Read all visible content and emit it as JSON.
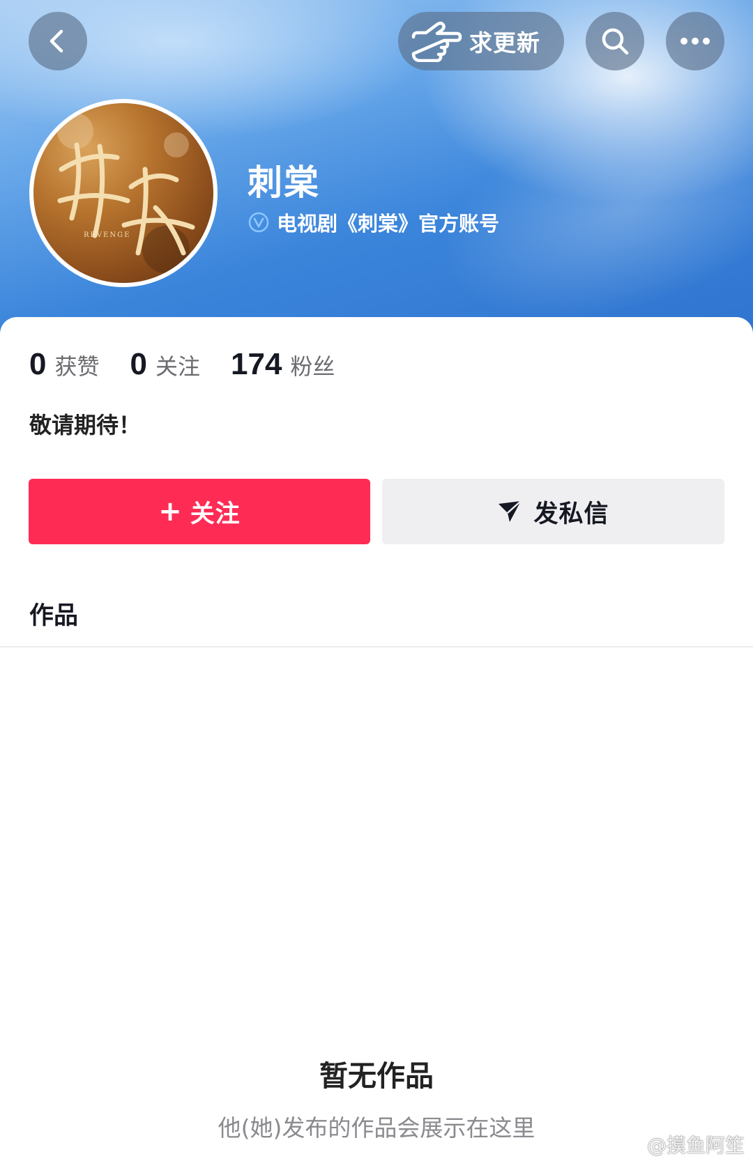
{
  "header": {
    "update_label": "求更新",
    "back_icon": "chevron-left-icon",
    "search_icon": "search-icon",
    "more_icon": "more-horizontal-icon",
    "update_icon": "pointing-hand-icon"
  },
  "profile": {
    "name": "刺棠",
    "verified_icon": "verified-v-icon",
    "verified_text": "电视剧《刺棠》官方账号",
    "avatar_text": "REVENGE"
  },
  "stats": [
    {
      "value": "0",
      "label": "获赞"
    },
    {
      "value": "0",
      "label": "关注"
    },
    {
      "value": "174",
      "label": "粉丝"
    }
  ],
  "bio": "敬请期待！",
  "actions": {
    "follow_label": "关注",
    "follow_plus": "+",
    "message_label": "发私信",
    "message_icon": "send-icon"
  },
  "tabs": {
    "works_label": "作品"
  },
  "empty_state": {
    "title": "暂无作品",
    "subtitle": "他(她)发布的作品会展示在这里"
  },
  "watermark": {
    "text": "@摸鱼阿笙",
    "icon": "weibo-icon"
  },
  "colors": {
    "accent_red": "#fe2c55",
    "banner_blue": "#3b85db",
    "message_bg": "#efeff1"
  }
}
